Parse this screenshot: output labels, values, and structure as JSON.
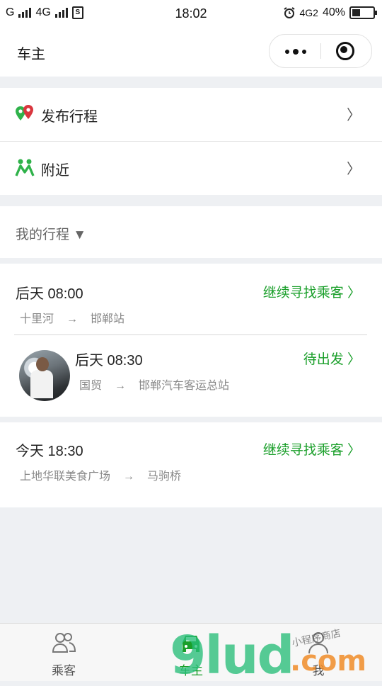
{
  "status_bar": {
    "carrier1": "G",
    "carrier2": "4G",
    "time": "18:02",
    "network": "4G2",
    "battery": "40%"
  },
  "header": {
    "title": "车主"
  },
  "menu": {
    "items": [
      {
        "label": "发布行程",
        "icon": "map-pin-icon",
        "chevron": "〉"
      },
      {
        "label": "附近",
        "icon": "people-icon",
        "chevron": "〉"
      }
    ]
  },
  "trips_header": {
    "label": "我的行程 ▼"
  },
  "trips": [
    {
      "time": "后天 08:00",
      "status": "继续寻找乘客 〉",
      "from": "十里河",
      "arrow": "→",
      "to": "邯郸站"
    },
    {
      "time": "后天 08:30",
      "status": "待出发 〉",
      "from": "国贸",
      "arrow": "→",
      "to": "邯郸汽车客运总站"
    },
    {
      "time": "今天 18:30",
      "status": "继续寻找乘客 〉",
      "from": "上地华联美食广场",
      "arrow": "→",
      "to": "马驹桥"
    }
  ],
  "tabs": [
    {
      "label": "乘客",
      "icon": "passenger-icon"
    },
    {
      "label": "车主",
      "icon": "car-icon"
    },
    {
      "label": "我",
      "icon": "user-icon"
    }
  ],
  "watermark": {
    "big": "9lud",
    "domain": ".com",
    "small": "小程序商店"
  },
  "colors": {
    "accent": "#1a9f2a",
    "background": "#eef0f3"
  }
}
